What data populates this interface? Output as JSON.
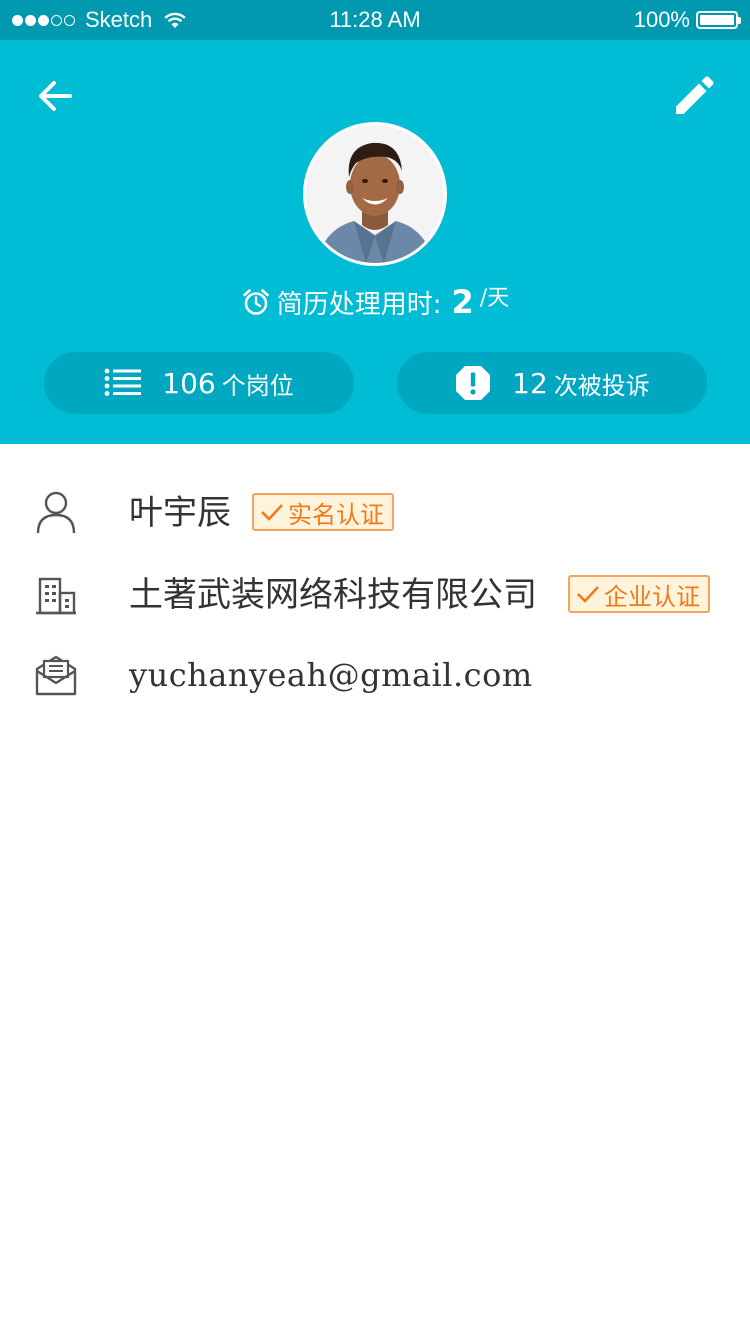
{
  "status_bar": {
    "carrier": "Sketch",
    "time": "11:28 AM",
    "battery": "100%"
  },
  "header": {
    "colors": {
      "background": "#00bcd4",
      "pill_background": "#00a7c0",
      "status_bar": "#0099b0"
    },
    "processing": {
      "label": "简历处理用时:",
      "value": "2",
      "unit": "/天"
    },
    "stats": {
      "jobs": {
        "count": "106",
        "label": "个岗位",
        "icon": "list-icon"
      },
      "complaints": {
        "count": "12",
        "label": "次被投诉",
        "icon": "alert-icon"
      }
    }
  },
  "profile": {
    "name": "叶宇辰",
    "name_badge": "实名认证",
    "company": "土著武装网络科技有限公司",
    "company_badge": "企业认证",
    "email": "yuchanyeah@gmail.com",
    "badge_colors": {
      "border": "#f6a35e",
      "background": "#fff3dc",
      "text": "#f07a1c"
    }
  }
}
